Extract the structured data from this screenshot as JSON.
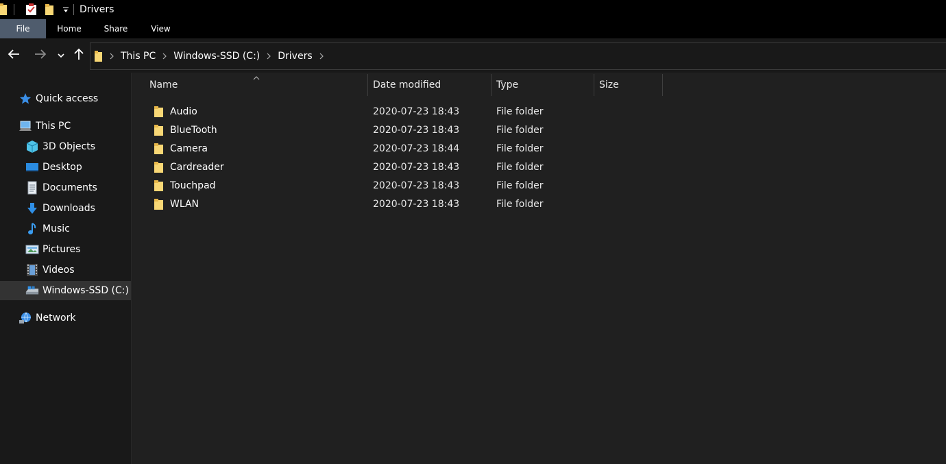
{
  "window": {
    "title": "Drivers"
  },
  "ribbon": {
    "tabs": [
      "File",
      "Home",
      "Share",
      "View"
    ]
  },
  "address": {
    "crumbs": [
      "This PC",
      "Windows-SSD (C:)",
      "Drivers"
    ]
  },
  "sidebar": {
    "quick_access": "Quick access",
    "this_pc": "This PC",
    "items": [
      "3D Objects",
      "Desktop",
      "Documents",
      "Downloads",
      "Music",
      "Pictures",
      "Videos",
      "Windows-SSD (C:)"
    ],
    "network": "Network",
    "selected": "Windows-SSD (C:)"
  },
  "columns": [
    "Name",
    "Date modified",
    "Type",
    "Size"
  ],
  "files": [
    {
      "name": "Audio",
      "date": "2020-07-23 18:43",
      "type": "File folder",
      "size": ""
    },
    {
      "name": "BlueTooth",
      "date": "2020-07-23 18:43",
      "type": "File folder",
      "size": ""
    },
    {
      "name": "Camera",
      "date": "2020-07-23 18:44",
      "type": "File folder",
      "size": ""
    },
    {
      "name": "Cardreader",
      "date": "2020-07-23 18:43",
      "type": "File folder",
      "size": ""
    },
    {
      "name": "Touchpad",
      "date": "2020-07-23 18:43",
      "type": "File folder",
      "size": ""
    },
    {
      "name": "WLAN",
      "date": "2020-07-23 18:43",
      "type": "File folder",
      "size": ""
    }
  ],
  "colors": {
    "folder": "#f8d775",
    "accent_file_tab": "#4f5c6d",
    "selected": "#333333"
  }
}
